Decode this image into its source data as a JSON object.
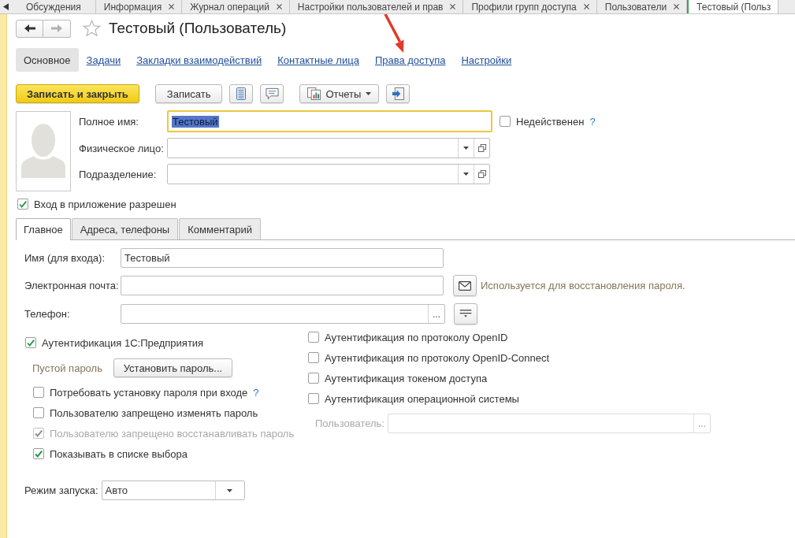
{
  "open_tabs": [
    {
      "label": "Обсуждения",
      "closable": false,
      "selected": false
    },
    {
      "label": "Информация",
      "closable": true,
      "selected": false
    },
    {
      "label": "Журнал операций",
      "closable": true,
      "selected": false
    },
    {
      "label": "Настройки пользователей и прав",
      "closable": true,
      "selected": false
    },
    {
      "label": "Профили групп доступа",
      "closable": true,
      "selected": false
    },
    {
      "label": "Пользователи",
      "closable": true,
      "selected": false
    },
    {
      "label": "Тестовый (Польз",
      "closable": false,
      "selected": true
    }
  ],
  "window": {
    "title": "Тестовый (Пользователь)",
    "favorite": false,
    "back_enabled": true,
    "forward_enabled": false
  },
  "sections": [
    {
      "label": "Основное",
      "selected": true
    },
    {
      "label": "Задачи",
      "selected": false
    },
    {
      "label": "Закладки взаимодействий",
      "selected": false
    },
    {
      "label": "Контактные лица",
      "selected": false
    },
    {
      "label": "Права доступа",
      "selected": false
    },
    {
      "label": "Настройки",
      "selected": false
    }
  ],
  "toolbar": {
    "save_and_close": "Записать и закрыть",
    "save": "Записать",
    "reports": "Отчеты"
  },
  "header_fields": [
    {
      "label": "Полное имя:",
      "kind": "text",
      "value": "Тестовый",
      "focused": true,
      "value_selected": true
    },
    {
      "label": "Физическое лицо:",
      "kind": "reference",
      "focused": false
    },
    {
      "label": "Подразделение:",
      "kind": "reference",
      "focused": false
    }
  ],
  "invalid": {
    "label": "Недейственен",
    "checked": false,
    "help": "?"
  },
  "login_allowed": {
    "label": "Вход в приложение разрешен",
    "checked": true
  },
  "page_tabs": [
    {
      "label": "Главное",
      "selected": true
    },
    {
      "label": "Адреса, телефоны",
      "selected": false
    },
    {
      "label": "Комментарий",
      "selected": false
    }
  ],
  "main_fields": [
    {
      "label": "Имя (для входа):",
      "kind": "text",
      "value": "Тестовый"
    },
    {
      "label": "Электронная почта:",
      "kind": "email",
      "hint": "Используется для восстановления пароля."
    },
    {
      "label": "Телефон:",
      "kind": "phone",
      "select_button": "..."
    }
  ],
  "auth_1c": {
    "label": "Аутентификация 1С:Предприятия",
    "checked": true,
    "password_status": "Пустой пароль",
    "set_password_button": "Установить пароль..."
  },
  "password_options": [
    {
      "label": "Потребовать установку пароля при входе",
      "checked": false,
      "disabled": false,
      "help": "?"
    },
    {
      "label": "Пользователю запрещено изменять пароль",
      "checked": false,
      "disabled": false
    },
    {
      "label": "Пользователю запрещено восстанавливать пароль",
      "checked": true,
      "disabled": true
    },
    {
      "label": "Показывать в списке выбора",
      "checked": true,
      "disabled": false
    }
  ],
  "launch_mode": {
    "label": "Режим запуска:",
    "value": "Авто"
  },
  "other_auth": [
    {
      "label": "Аутентификация по протоколу OpenID",
      "checked": false
    },
    {
      "label": "Аутентификация по протоколу OpenID-Connect",
      "checked": false
    },
    {
      "label": "Аутентификация токеном доступа",
      "checked": false
    },
    {
      "label": "Аутентификация операционной системы",
      "checked": false
    }
  ],
  "os_user": {
    "label": "Пользователь:",
    "disabled": true,
    "select_button": "..."
  }
}
